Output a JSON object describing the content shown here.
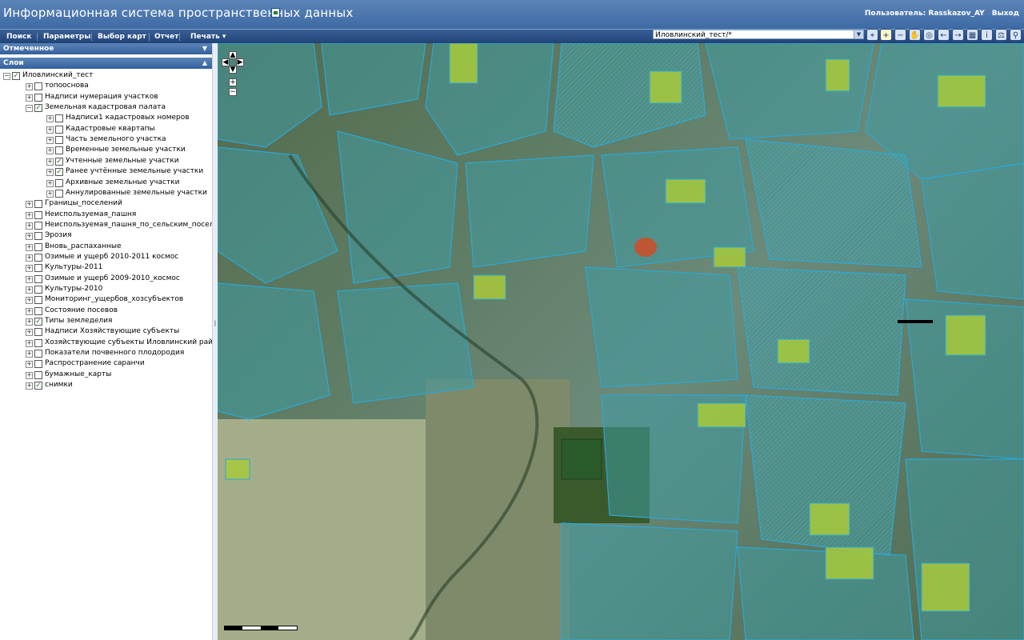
{
  "app": {
    "title": "Информационная система пространственных данных"
  },
  "user": {
    "label": "Пользователь: Rasskazov_AY",
    "logout": "Выход"
  },
  "menu": [
    {
      "label": "Поиск"
    },
    {
      "label": "Параметры"
    },
    {
      "label": "Выбор карт"
    },
    {
      "label": "Отчет"
    },
    {
      "label": "Печать ▾"
    }
  ],
  "map_selector": {
    "value": "Иловлинский_тест/*"
  },
  "toolbar_icons": [
    "identify-icon",
    "zoom-in-icon",
    "zoom-out-icon",
    "pan-hand-icon",
    "full-extent-icon",
    "back-arrow-icon",
    "forward-arrow-icon",
    "clear-icon",
    "info-icon",
    "measure-icon",
    "search-map-icon"
  ],
  "panels": {
    "marked": "Отмеченное",
    "layers": "Слои"
  },
  "layers": [
    {
      "label": "Иловлинский_тест",
      "level": 0,
      "checked": true,
      "expanded": true
    },
    {
      "label": "топооснова",
      "level": 1,
      "checked": false,
      "expanded": false
    },
    {
      "label": "Надписи нумерация участков",
      "level": 1,
      "checked": false,
      "expanded": false
    },
    {
      "label": "Земельная кадастровая палата",
      "level": 1,
      "checked": true,
      "expanded": true
    },
    {
      "label": "Надписи1 кадастровых номеров",
      "level": 2,
      "checked": false,
      "expanded": false
    },
    {
      "label": "Кадастровые квартапы",
      "level": 2,
      "checked": false,
      "expanded": false
    },
    {
      "label": "Часть земельного участка",
      "level": 2,
      "checked": false,
      "expanded": false
    },
    {
      "label": "Временные земельные участки",
      "level": 2,
      "checked": false,
      "expanded": false
    },
    {
      "label": "Учтенные земельные участки",
      "level": 2,
      "checked": true,
      "expanded": false
    },
    {
      "label": "Ранее учтённые земельные участки",
      "level": 2,
      "checked": true,
      "expanded": false
    },
    {
      "label": "Архивные земельные участки",
      "level": 2,
      "checked": false,
      "expanded": false
    },
    {
      "label": "Аннулированные земельные участки",
      "level": 2,
      "checked": false,
      "expanded": false
    },
    {
      "label": "Границы_поселений",
      "level": 1,
      "checked": false,
      "expanded": false
    },
    {
      "label": "Неиспользуемая_пашня",
      "level": 1,
      "checked": false,
      "expanded": false
    },
    {
      "label": "Неиспользуемая_пашня_по_сельским_поселениям",
      "level": 1,
      "checked": false,
      "expanded": false
    },
    {
      "label": "Эрозия",
      "level": 1,
      "checked": false,
      "expanded": false
    },
    {
      "label": "Вновь_распаханные",
      "level": 1,
      "checked": false,
      "expanded": false
    },
    {
      "label": "Озимые и ущерб 2010-2011 космос",
      "level": 1,
      "checked": false,
      "expanded": false
    },
    {
      "label": "Культуры-2011",
      "level": 1,
      "checked": false,
      "expanded": false
    },
    {
      "label": "Озимые и ущерб 2009-2010_космос",
      "level": 1,
      "checked": false,
      "expanded": false
    },
    {
      "label": "Культуры-2010",
      "level": 1,
      "checked": false,
      "expanded": false
    },
    {
      "label": "Мониторинг_ущербов_хозсубъектов",
      "level": 1,
      "checked": false,
      "expanded": false
    },
    {
      "label": "Состояние посевов",
      "level": 1,
      "checked": false,
      "expanded": false
    },
    {
      "label": "Типы земледелия",
      "level": 1,
      "checked": true,
      "expanded": false
    },
    {
      "label": "Надписи Хозяйствующие субъекты",
      "level": 1,
      "checked": false,
      "expanded": false
    },
    {
      "label": "Хозяйствующие субъекты Иловлинский район",
      "level": 1,
      "checked": false,
      "expanded": false
    },
    {
      "label": "Показатели почвенного плодородия",
      "level": 1,
      "checked": false,
      "expanded": false
    },
    {
      "label": "Распространение саранчи",
      "level": 1,
      "checked": false,
      "expanded": false
    },
    {
      "label": "бумажные_карты",
      "level": 1,
      "checked": false,
      "expanded": false
    },
    {
      "label": "снимки",
      "level": 1,
      "checked": true,
      "expanded": false
    }
  ],
  "colors": {
    "header": "#4a76ad",
    "parcel_outline": "#2aa8d8",
    "parcel_fill": "#3f9aa3",
    "crop_fill": "#a8c93a",
    "accent_red": "#c8502a"
  }
}
